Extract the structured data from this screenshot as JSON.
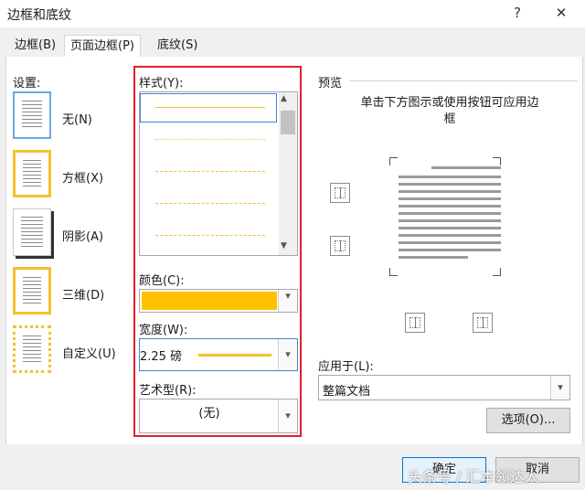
{
  "window": {
    "title": "边框和底纹",
    "help": "?",
    "close": "✕"
  },
  "tabs": [
    {
      "label": "边框(B)"
    },
    {
      "label": "页面边框(P)"
    },
    {
      "label": "底纹(S)"
    }
  ],
  "settings": {
    "label": "设置:",
    "items": [
      {
        "label": "无(N)"
      },
      {
        "label": "方框(X)"
      },
      {
        "label": "阴影(A)"
      },
      {
        "label": "三维(D)"
      },
      {
        "label": "自定义(U)"
      }
    ]
  },
  "style": {
    "label": "样式(Y):",
    "scroll_up": "▲",
    "scroll_down": "▼"
  },
  "color": {
    "label": "颜色(C):",
    "value": "#ffc000"
  },
  "width": {
    "label": "宽度(W):",
    "value": "2.25 磅"
  },
  "art": {
    "label": "艺术型(R):",
    "value": "(无)"
  },
  "preview": {
    "label": "预览",
    "instruction": "单击下方图示或使用按钮可应用边框"
  },
  "apply_to": {
    "label": "应用于(L):",
    "value": "整篇文档"
  },
  "buttons": {
    "options": "选项(O)...",
    "ok": "确定",
    "cancel": "取消"
  },
  "watermark": "头条号 / 汇本领达人"
}
